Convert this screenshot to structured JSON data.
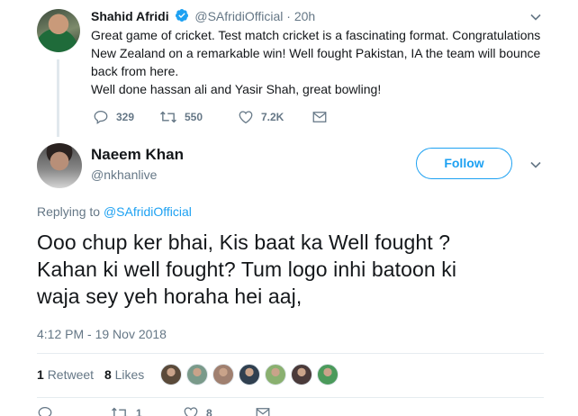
{
  "parent_tweet": {
    "name": "Shahid Afridi",
    "handle": "@SAfridiOfficial",
    "separator": "·",
    "time": "20h",
    "text_lines": [
      "Great game of cricket. Test match cricket is a fascinating format. Congratulations",
      "New Zealand on a remarkable win! Well fought Pakistan, IA the team will bounce",
      "back from here.",
      "Well done hassan ali and Yasir Shah, great bowling!"
    ],
    "replies": "329",
    "retweets": "550",
    "likes": "7.2K"
  },
  "main_tweet": {
    "name": "Naeem Khan",
    "handle": "@nkhanlive",
    "follow_label": "Follow",
    "replying_prefix": "Replying to",
    "replying_handle": "@SAfridiOfficial",
    "text_lines": [
      "Ooo chup ker bhai, Kis baat ka Well fought ?",
      "Kahan ki well fought? Tum logo inhi batoon ki",
      "waja sey yeh horaha hei aaj,"
    ],
    "timestamp": "4:12 PM - 19 Nov 2018",
    "retweet_count": "1",
    "retweet_label": "Retweet",
    "like_count": "8",
    "like_label": "Likes",
    "bottom_retweets": "1",
    "bottom_likes": "8"
  },
  "colors": {
    "accent": "#1da1f2",
    "secondary_text": "#657786",
    "primary_text": "#14171a",
    "divider": "#e6ecf0"
  },
  "likers": [
    {
      "icon": "avatar-1",
      "bg": "#5a4a3a"
    },
    {
      "icon": "avatar-2",
      "bg": "#7a9a8a"
    },
    {
      "icon": "avatar-3",
      "bg": "#a08070"
    },
    {
      "icon": "avatar-4",
      "bg": "#304050"
    },
    {
      "icon": "avatar-5",
      "bg": "#8ab070"
    },
    {
      "icon": "avatar-6",
      "bg": "#4a3a3a"
    },
    {
      "icon": "avatar-7",
      "bg": "#4b9a5b"
    }
  ]
}
